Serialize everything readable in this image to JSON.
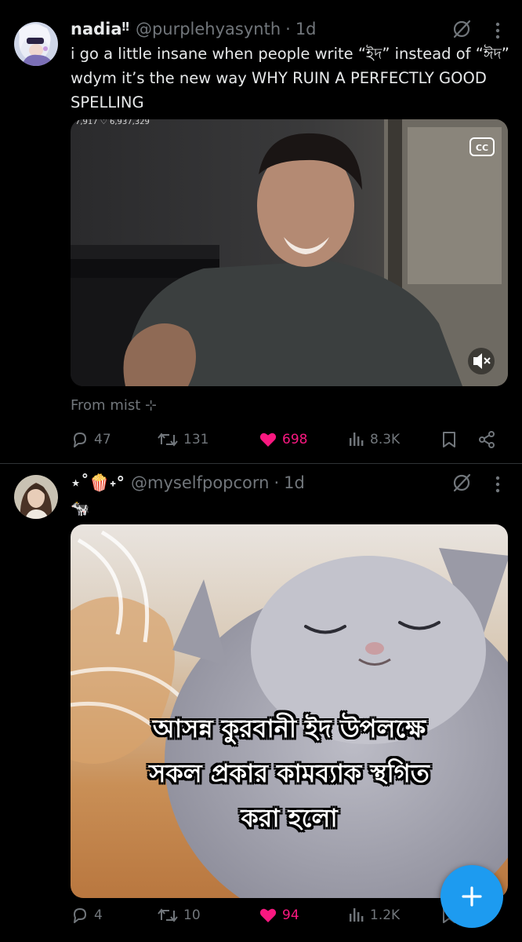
{
  "posts": [
    {
      "display_name": "nadia",
      "name_suffix": "‼",
      "handle": "@purplehyasynth",
      "separator": "·",
      "time": "1d",
      "text": "i go a little insane when people write “ইদ” instead of “ঈদ” wdym it’s the new way WHY RUIN A PERFECTLY GOOD SPELLING",
      "media_overlay_text": "7,917  ♡ 6,937,329",
      "media_cc_label": "CC",
      "from_label": "From mist ⊹",
      "actions": {
        "replies": "47",
        "reposts": "131",
        "likes": "698",
        "views": "8.3K"
      },
      "liked": true
    },
    {
      "display_name": "⋆˚🍿˖°",
      "handle": "@myselfpopcorn",
      "separator": "·",
      "time": "1d",
      "text": "🐄",
      "media_caption": [
        "আসন্ন কুরবানী ইদ উপলক্ষে",
        "সকল প্রকার কামব্যাক স্থগিত",
        "করা হলো"
      ],
      "actions": {
        "replies": "4",
        "reposts": "10",
        "likes": "94",
        "views": "1.2K"
      },
      "liked": true
    }
  ],
  "fab_label": "+",
  "colors": {
    "background": "#000000",
    "text": "#e7e9ea",
    "muted": "#71767b",
    "like": "#f91880",
    "accent": "#1d9bf0",
    "divider": "#2f3336"
  },
  "icons": [
    "grok-icon",
    "more-icon",
    "reply-icon",
    "repost-icon",
    "like-icon",
    "views-icon",
    "bookmark-icon",
    "share-icon",
    "cc-icon",
    "mute-icon",
    "plus-icon"
  ]
}
